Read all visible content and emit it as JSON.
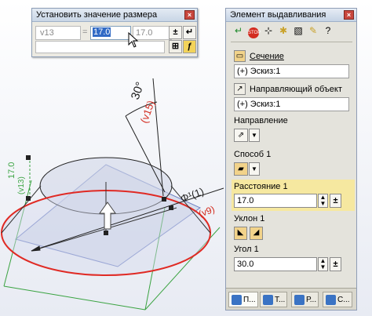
{
  "dim_dialog": {
    "title": "Установить значение размера",
    "variable": "v13",
    "equals": "=",
    "value": "17.0",
    "previous_value": "17.0",
    "plus_minus": "±",
    "enter": "↵",
    "close": "×"
  },
  "drawing": {
    "angle_label": "30°",
    "angle_var": "(v15)",
    "diameter_label": "Φ¹(1)",
    "diameter_var": "(v9)",
    "height_label": "17.0",
    "height_var": "(v13)"
  },
  "panel": {
    "title": "Элемент выдавливания",
    "section_label": "Сечение",
    "section_value": "(+) Эскиз:1",
    "guide_label": "Направляющий объект",
    "guide_value": "(+) Эскиз:1",
    "direction_label": "Направление",
    "method_label": "Способ 1",
    "distance_label": "Расстояние 1",
    "distance_value": "17.0",
    "slope_label": "Уклон 1",
    "angle_label": "Угол 1",
    "angle_value": "30.0",
    "plus_minus": "±",
    "tabs": [
      "П...",
      "Т...",
      "Р...",
      "С..."
    ]
  },
  "colors": {
    "ellipse_red": "#e02a24",
    "accent_red": "#d32c20",
    "green_lines": "#3aa341",
    "highlight": "#f6e8a0"
  }
}
